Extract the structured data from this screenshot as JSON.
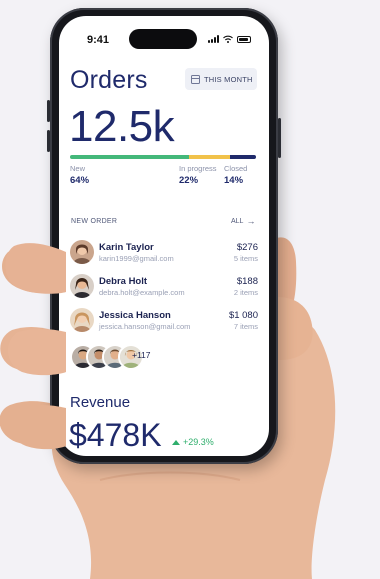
{
  "status_bar": {
    "time": "9:41"
  },
  "header": {
    "title": "Orders",
    "period_label": "THIS MONTH"
  },
  "summary": {
    "total": "12.5k",
    "stats": [
      {
        "label": "New",
        "value": "64%",
        "fraction": 0.64,
        "color": "#44b87a"
      },
      {
        "label": "In progress",
        "value": "22%",
        "fraction": 0.22,
        "color": "#f1c24a"
      },
      {
        "label": "Closed",
        "value": "14%",
        "fraction": 0.14,
        "color": "#1f2a6b"
      }
    ]
  },
  "new_orders": {
    "section_label": "NEW ORDER",
    "all_label": "ALL",
    "rows": [
      {
        "name": "Karin Taylor",
        "email": "karin1999@gmail.com",
        "amount": "$276",
        "items": "5 items"
      },
      {
        "name": "Debra Holt",
        "email": "debra.holt@example.com",
        "amount": "$188",
        "items": "2 items"
      },
      {
        "name": "Jessica Hanson",
        "email": "jessica.hanson@gmail.com",
        "amount": "$1 080",
        "items": "7 items"
      }
    ],
    "more_count": "+117"
  },
  "revenue": {
    "title": "Revenue",
    "value": "$478K",
    "change": "+29.3%"
  },
  "colors": {
    "accent": "#1f2a6b",
    "positive": "#2fae6c",
    "new": "#44b87a",
    "progress": "#f1c24a"
  }
}
